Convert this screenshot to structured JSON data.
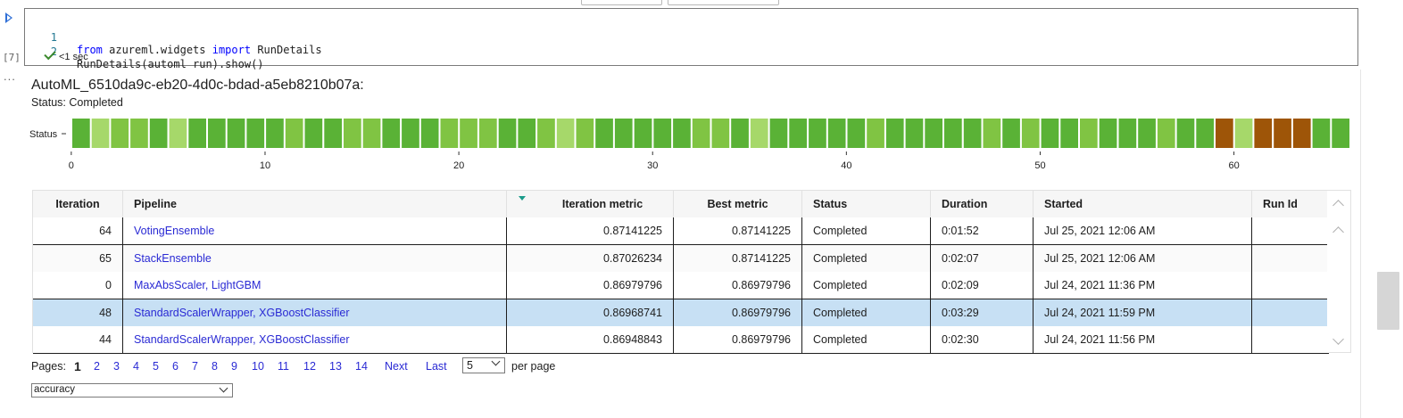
{
  "cell": {
    "execution_count": "[7]",
    "more_label": "...",
    "code_lines": [
      {
        "num": "1",
        "kw1": "from",
        "mid": " azureml.widgets ",
        "kw2": "import",
        "rest": " RunDetails"
      },
      {
        "num": "2",
        "text": "RunDetails(automl_run).show()"
      }
    ],
    "exec_time": "<1 sec"
  },
  "widget": {
    "run_title": "AutoML_6510da9c-eb20-4d0c-bdad-a5eb8210b07a:",
    "status_text": "Status: Completed"
  },
  "chart_data": {
    "type": "heatmap",
    "ylabel": "Status",
    "x_ticks": [
      0,
      10,
      20,
      30,
      40,
      50,
      60
    ],
    "iterations": 66,
    "colors": {
      "best": "#5ab236",
      "mid": "#80c443",
      "light": "#a6d86a",
      "failed": "#9e5508"
    },
    "statuses": [
      "best",
      "light",
      "mid",
      "mid",
      "best",
      "light",
      "best",
      "best",
      "best",
      "best",
      "best",
      "mid",
      "best",
      "best",
      "mid",
      "mid",
      "best",
      "best",
      "best",
      "mid",
      "mid",
      "mid",
      "best",
      "best",
      "mid",
      "light",
      "mid",
      "best",
      "best",
      "best",
      "best",
      "best",
      "mid",
      "mid",
      "best",
      "light",
      "best",
      "best",
      "best",
      "best",
      "best",
      "mid",
      "best",
      "best",
      "best",
      "best",
      "best",
      "mid",
      "best",
      "mid",
      "best",
      "best",
      "mid",
      "best",
      "best",
      "best",
      "mid",
      "best",
      "best",
      "failed",
      "light",
      "failed",
      "failed",
      "failed",
      "best",
      "best"
    ]
  },
  "table": {
    "columns": [
      "Iteration",
      "Pipeline",
      "Iteration metric",
      "Best metric",
      "Status",
      "Duration",
      "Started",
      "Run Id"
    ],
    "rows": [
      {
        "iteration": "64",
        "pipeline": "VotingEnsemble",
        "metric": "0.87141225",
        "best": "0.87141225",
        "status": "Completed",
        "duration": "0:01:52",
        "started": "Jul 25, 2021 12:06 AM",
        "run_id": ""
      },
      {
        "iteration": "65",
        "pipeline": "StackEnsemble",
        "metric": "0.87026234",
        "best": "0.87141225",
        "status": "Completed",
        "duration": "0:02:07",
        "started": "Jul 25, 2021 12:06 AM",
        "run_id": ""
      },
      {
        "iteration": "0",
        "pipeline": "MaxAbsScaler, LightGBM",
        "metric": "0.86979796",
        "best": "0.86979796",
        "status": "Completed",
        "duration": "0:02:09",
        "started": "Jul 24, 2021 11:36 PM",
        "run_id": ""
      },
      {
        "iteration": "48",
        "pipeline": "StandardScalerWrapper, XGBoostClassifier",
        "metric": "0.86968741",
        "best": "0.86979796",
        "status": "Completed",
        "duration": "0:03:29",
        "started": "Jul 24, 2021 11:59 PM",
        "run_id": ""
      },
      {
        "iteration": "44",
        "pipeline": "StandardScalerWrapper, XGBoostClassifier",
        "metric": "0.86948843",
        "best": "0.86979796",
        "status": "Completed",
        "duration": "0:02:30",
        "started": "Jul 24, 2021 11:56 PM",
        "run_id": ""
      }
    ],
    "selected_row": 3
  },
  "pager": {
    "label": "Pages:",
    "pages": [
      "1",
      "2",
      "3",
      "4",
      "5",
      "6",
      "7",
      "8",
      "9",
      "10",
      "11",
      "12",
      "13",
      "14"
    ],
    "current": "1",
    "next": "Next",
    "last": "Last",
    "per_page_value": "5",
    "per_page_label": "per page"
  },
  "metric_select": {
    "value": "accuracy"
  }
}
